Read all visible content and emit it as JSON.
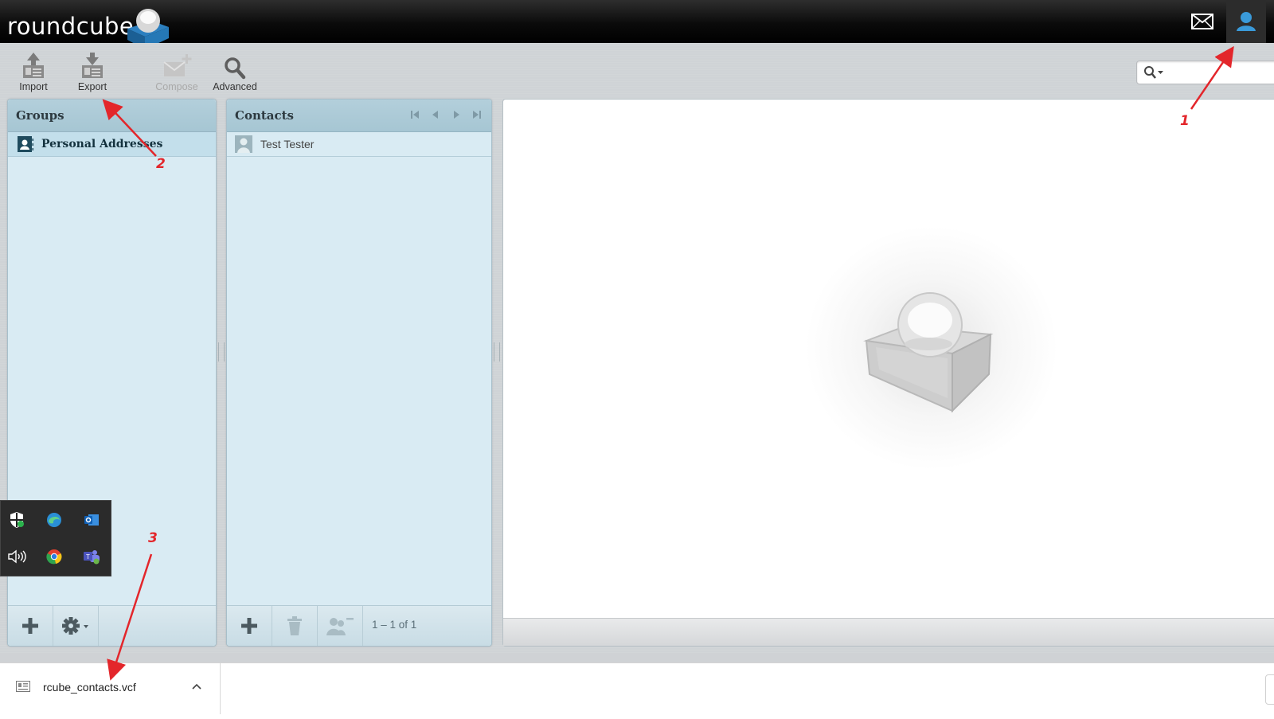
{
  "app": {
    "logo_text": "roundcube"
  },
  "topnav": {
    "mail_icon": "envelope-icon",
    "contacts_icon": "person-icon"
  },
  "toolbar": {
    "import_label": "Import",
    "export_label": "Export",
    "compose_label": "Compose",
    "advanced_label": "Advanced"
  },
  "search": {
    "placeholder": ""
  },
  "groups": {
    "title": "Groups",
    "items": [
      {
        "label": "Personal Addresses"
      }
    ]
  },
  "contacts": {
    "title": "Contacts",
    "items": [
      {
        "label": "Test Tester"
      }
    ],
    "pagination": "1 – 1 of 1"
  },
  "download": {
    "filename": "rcube_contacts.vcf"
  },
  "annotations": {
    "one": "1",
    "two": "2",
    "three": "3"
  },
  "colors": {
    "annotation": "#e3262b",
    "accent_blue": "#3a9ad9",
    "panel_bg": "#d9ebf3"
  }
}
